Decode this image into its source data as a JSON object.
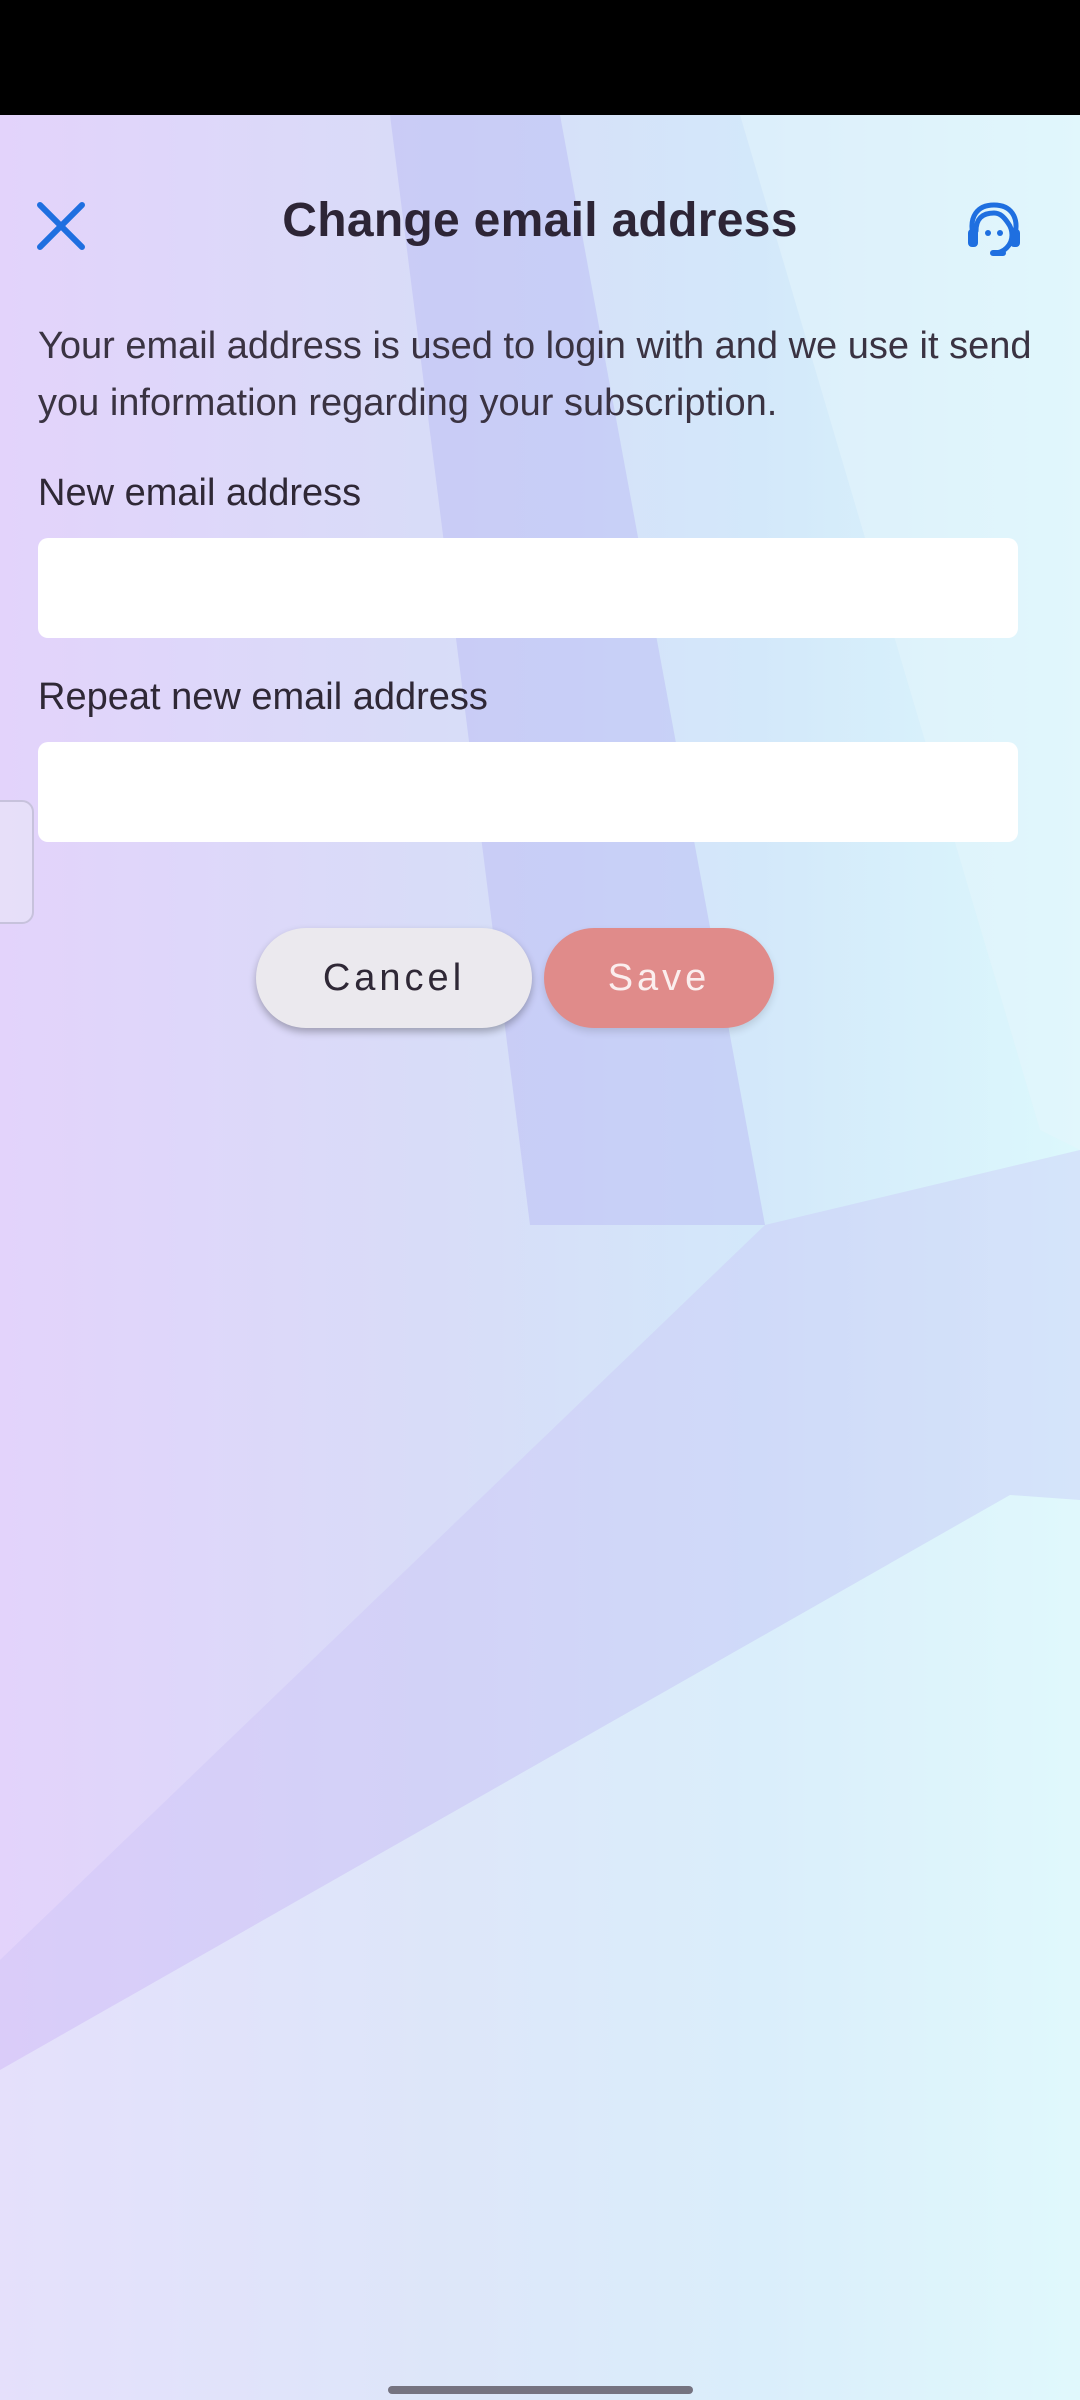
{
  "header": {
    "title": "Change email address",
    "close_icon": "close-icon",
    "support_icon": "headset-support-icon"
  },
  "description": "Your email address is used to login with and we use it send you information regarding your subscription.",
  "form": {
    "new_email": {
      "label": "New email address",
      "value": "",
      "placeholder": ""
    },
    "repeat_email": {
      "label": "Repeat new email address",
      "value": "",
      "placeholder": ""
    }
  },
  "actions": {
    "cancel_label": "Cancel",
    "save_label": "Save"
  },
  "colors": {
    "accent": "#1f6fe0",
    "save_button": "#e08b8a",
    "cancel_button": "#ebe9ee",
    "status_bar": "#000000"
  }
}
